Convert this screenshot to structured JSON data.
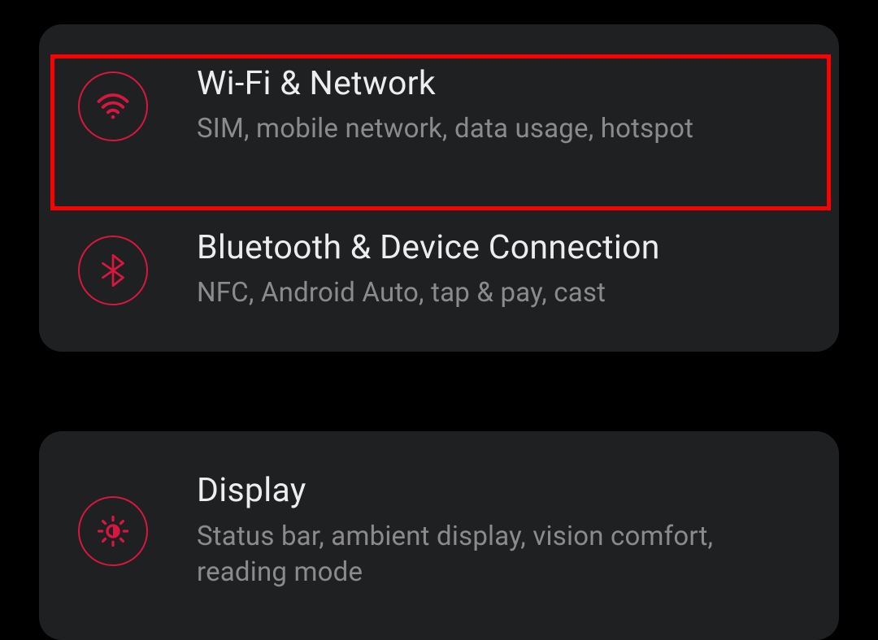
{
  "colors": {
    "accent": "#d9163f",
    "background": "#000000",
    "card": "#1f2022",
    "title": "#ededed",
    "subtitle": "#8b8b8d",
    "highlight": "#ff0000"
  },
  "groups": [
    {
      "items": [
        {
          "icon": "wifi-icon",
          "title": "Wi-Fi & Network",
          "subtitle": "SIM, mobile network, data usage, hotspot",
          "highlighted": true
        },
        {
          "icon": "bluetooth-icon",
          "title": "Bluetooth & Device Connection",
          "subtitle": "NFC, Android Auto, tap & pay, cast",
          "highlighted": false
        }
      ]
    },
    {
      "items": [
        {
          "icon": "display-icon",
          "title": "Display",
          "subtitle": "Status bar, ambient display, vision comfort, reading mode",
          "highlighted": false
        }
      ]
    }
  ]
}
